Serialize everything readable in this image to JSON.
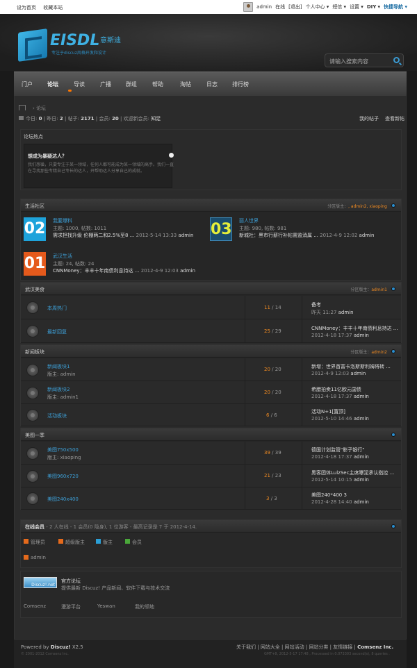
{
  "topbar": {
    "set_home": "设为首页",
    "favorite": "收藏本站",
    "user": "admin",
    "online": "在线",
    "logout": "[退出]",
    "personal": "个人中心",
    "messages": "短信",
    "settings": "设置",
    "diy": "DIY",
    "quick_nav": "快捷导航"
  },
  "header": {
    "logo": "EISDL",
    "logo_cn": "意斯迪",
    "slogan": "专注于discuz风格开发和设计",
    "search_placeholder": "请输入搜索内容"
  },
  "nav": [
    "门户",
    "论坛",
    "导读",
    "广播",
    "群组",
    "帮助",
    "淘帖",
    "日志",
    "排行榜"
  ],
  "breadcrumb": {
    "label": "论坛"
  },
  "stats": {
    "today_label": "今日:",
    "today": "0",
    "yesterday_label": "昨日:",
    "yesterday": "2",
    "posts_label": "帖子:",
    "posts": "2171",
    "members_label": "会员:",
    "members": "20",
    "new_member_label": "欢迎新会员:",
    "new_member": "知足",
    "my_posts": "我的帖子",
    "view_new": "查看新帖"
  },
  "hot": {
    "title": "论坛热点",
    "question": "想成为暴疑达人？",
    "desc1": "我们想循，只要专注于某一领域，任何人都可能成为某一领域的高手。我们一直在寻找那些专精自己专长的达人，开帮助达人分享自己的成就。"
  },
  "cat1": {
    "title": "生活社区",
    "moderator_label": "分区版主：",
    "moderator": ", admin2, xiaoping",
    "forums": [
      {
        "num": "02",
        "name": "我要爆料",
        "stats": "主题: 1000, 帖数: 1011",
        "last": "需求担找升级 伦棚两二和2.5%至8 ...",
        "date": "2012-5-14 13:33",
        "by": "admin",
        "color": "#1ea3db"
      },
      {
        "num": "03",
        "name": "丽人世界",
        "stats": "主题: 980, 帖数: 981",
        "last": "新城社：黑市行薪行补帖需监消属 ...",
        "date": "2012-4-9 12:02",
        "by": "admin",
        "color": "#1a4d6e"
      },
      {
        "num": "01",
        "name": "武汉生活",
        "stats": "主题: 24, 帖数: 24",
        "last": "CNNMoney：丰丰十年南债利息持达 ...",
        "date": "2012-4-9 12:03",
        "by": "admin",
        "color": "#e55a1c"
      }
    ]
  },
  "cat2": {
    "title": "武汉美食",
    "moderator_label": "分区版主：",
    "moderator": "admin1",
    "rows": [
      {
        "name": "本周热门",
        "mod": "",
        "a": "11",
        "b": "14",
        "last": "备考",
        "date": "昨天 11:27",
        "by": "admin"
      },
      {
        "name": "最新回复",
        "mod": "",
        "a": "25",
        "b": "29",
        "last": "CNNMoney：丰丰十年南债利息持达 ...",
        "date": "2012-4-18 17:37",
        "by": "admin"
      }
    ]
  },
  "cat3": {
    "title": "新闻板块",
    "moderator_label": "分区版主：",
    "moderator": "admin2",
    "rows": [
      {
        "name": "新闻板块1",
        "mod": "版主: admin",
        "a": "20",
        "b": "20",
        "last": "新增：世界首富卡洛斯斯利姆将转 ...",
        "date": "2012-4-9 12:03",
        "by": "admin"
      },
      {
        "name": "新闻板块2",
        "mod": "版主: admin1",
        "a": "20",
        "b": "20",
        "last": "希腊拍卖11亿欧元国债",
        "date": "2012-4-18 17:37",
        "by": "admin"
      },
      {
        "name": "活动板块",
        "mod": "",
        "a": "6",
        "b": "6",
        "last": "活动N+1[置顶]",
        "date": "2012-5-10 14:46",
        "by": "admin"
      }
    ]
  },
  "cat4": {
    "title": "美图一季",
    "rows": [
      {
        "name": "美图750x500",
        "mod": "版主: xiaoping",
        "a": "39",
        "b": "39",
        "last": "德国计划监管\"影子银行\"",
        "date": "2012-4-18 17:37",
        "by": "admin"
      },
      {
        "name": "美图960x720",
        "mod": "",
        "a": "21",
        "b": "23",
        "last": "黑客团体LulzSec主席曝泥承认指控 ...",
        "date": "2012-5-14 10:15",
        "by": "admin"
      },
      {
        "name": "美图240x400",
        "mod": "",
        "a": "3",
        "b": "3",
        "last": "美图240*400 3",
        "date": "2012-4-28 14:40",
        "by": "admin"
      }
    ]
  },
  "online": {
    "title": "在线会员",
    "info": "- 2 人在线 - 1 会员(0 隐身), 1 位游客 - 最高记录是 7 于 2012-4-14.",
    "legend": [
      "管理员",
      "超级版主",
      "版主",
      "会员"
    ],
    "user": "admin"
  },
  "links": {
    "title": "官方论坛",
    "desc": "提供最新 Discuz! 产品新闻、软件下载与技术交流",
    "logo": "Discuz!.net",
    "items": [
      "Comsenz",
      "漫游平台",
      "Yeswan",
      "我的领地"
    ]
  },
  "footer": {
    "powered": "Powered by",
    "brand": "Discuz!",
    "ver": "X2.5",
    "copy": "© 2001-2012 Comsenz Inc.",
    "links": [
      "关于我们",
      "网站大全",
      "网站活动",
      "网站分类",
      "友情链接"
    ],
    "comsenz": "Comsenz Inc.",
    "meta": "GMT+8, 2012-5-17 17:48 , Processed in 0.073303 second(s), 8 queries ."
  }
}
